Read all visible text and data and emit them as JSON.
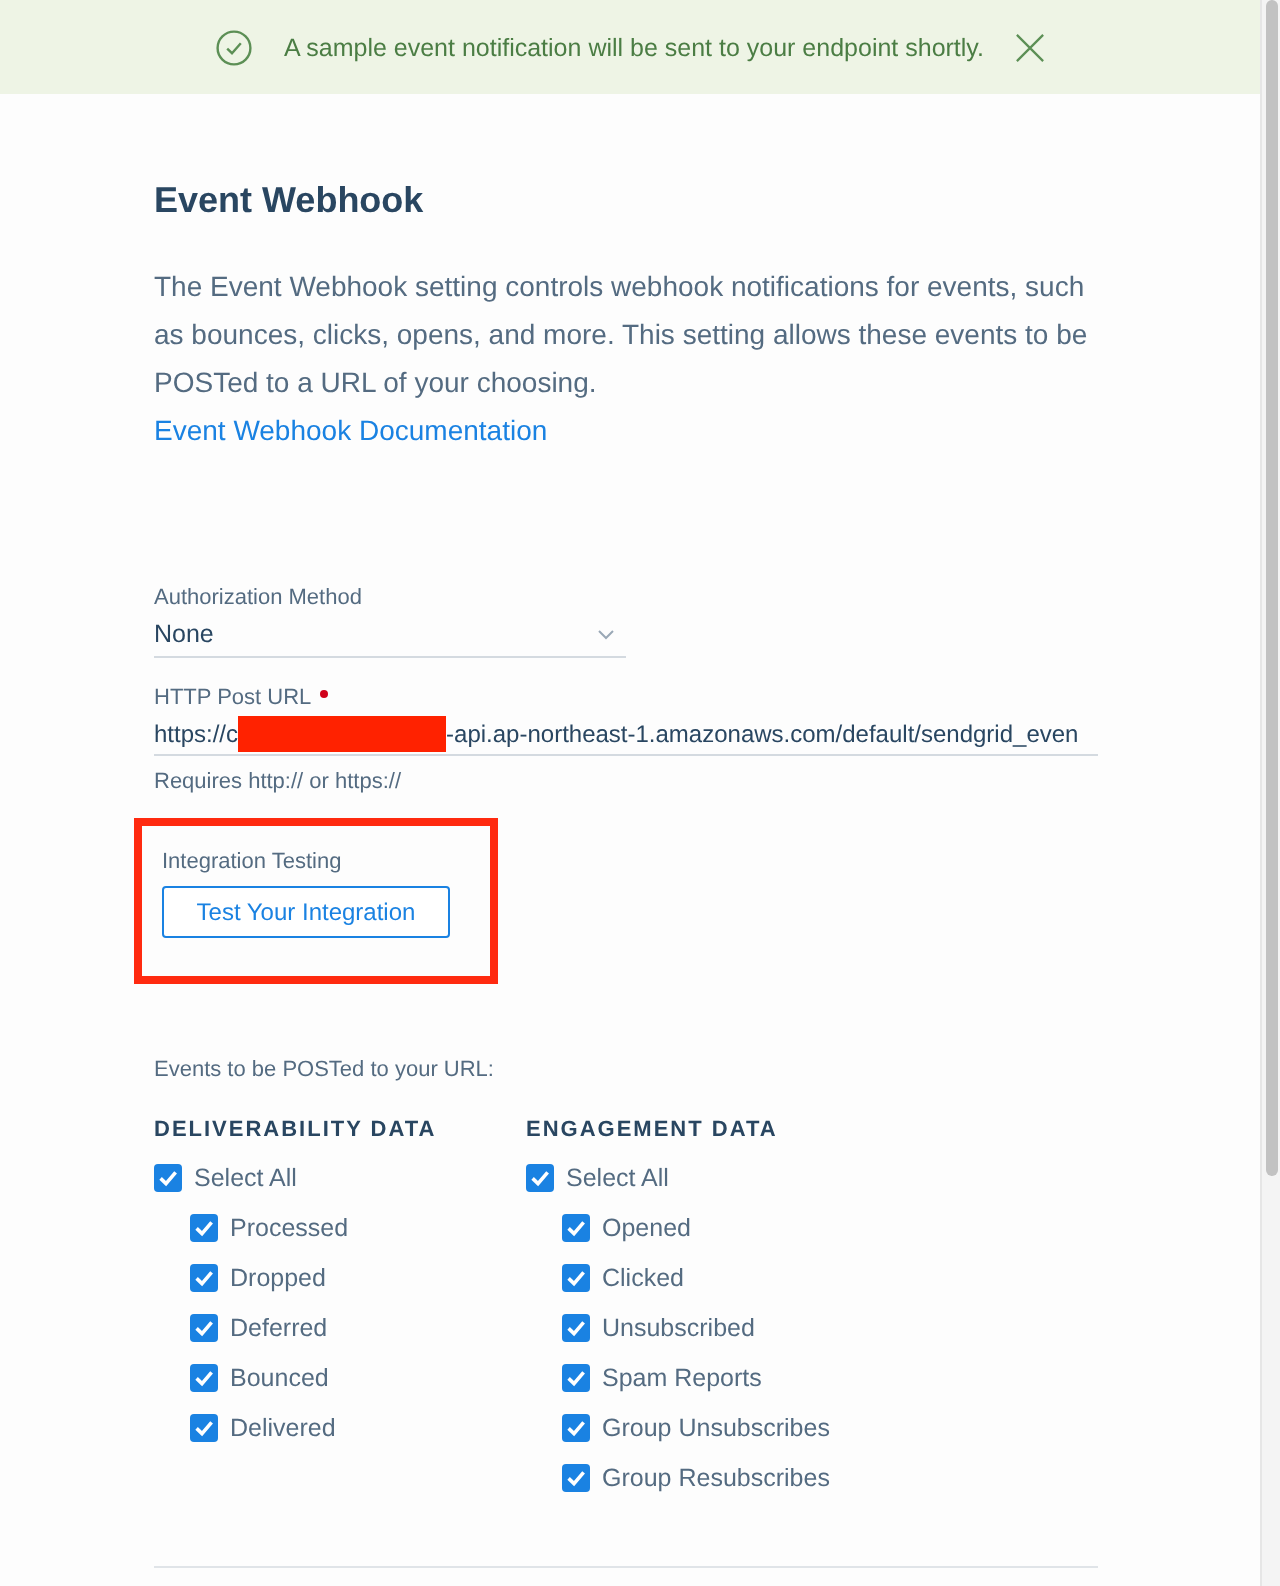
{
  "notification": {
    "message": "A sample event notification will be sent to your endpoint shortly."
  },
  "section": {
    "title": "Event Webhook",
    "description": "The Event Webhook setting controls webhook notifications for events, such as bounces, clicks, opens, and more. This setting allows these events to be POSTed to a URL of your choosing.",
    "link": "Event Webhook Documentation"
  },
  "form": {
    "auth": {
      "label": "Authorization Method",
      "value": "None"
    },
    "url": {
      "label": "HTTP Post URL",
      "required": true,
      "value_start": "https://c",
      "redacted": true,
      "value_end": "-api.ap-northeast-1.amazonaws.com/default/sendgrid_even",
      "hint": "Requires http:// or https://"
    },
    "integration": {
      "label": "Integration Testing",
      "button": "Test Your Integration",
      "highlighted": true
    },
    "events_label": "Events to be POSTed to your URL:"
  },
  "event_groups": [
    {
      "title": "DELIVERABILITY DATA",
      "select_all": {
        "label": "Select All",
        "checked": true
      },
      "items": [
        {
          "label": "Processed",
          "checked": true
        },
        {
          "label": "Dropped",
          "checked": true
        },
        {
          "label": "Deferred",
          "checked": true
        },
        {
          "label": "Bounced",
          "checked": true
        },
        {
          "label": "Delivered",
          "checked": true
        }
      ]
    },
    {
      "title": "ENGAGEMENT DATA",
      "select_all": {
        "label": "Select All",
        "checked": true
      },
      "items": [
        {
          "label": "Opened",
          "checked": true
        },
        {
          "label": "Clicked",
          "checked": true
        },
        {
          "label": "Unsubscribed",
          "checked": true
        },
        {
          "label": "Spam Reports",
          "checked": true
        },
        {
          "label": "Group Unsubscribes",
          "checked": true
        },
        {
          "label": "Group Resubscribes",
          "checked": true
        }
      ]
    }
  ]
}
